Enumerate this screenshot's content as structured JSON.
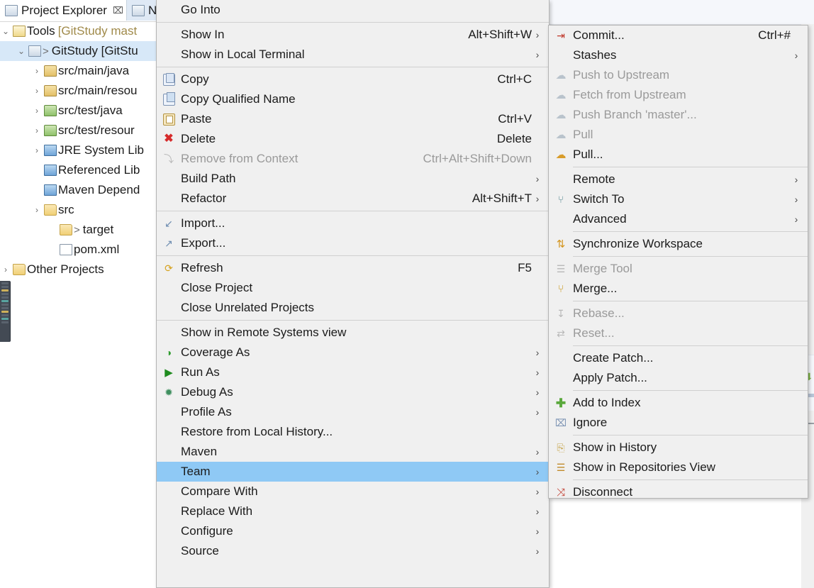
{
  "explorer": {
    "tabs": [
      {
        "label": "Project Explorer",
        "icon": "project-explorer-icon",
        "close": "⌧",
        "active": true
      },
      {
        "label": "Na",
        "icon": "navigator-icon",
        "active": false
      }
    ],
    "tree": [
      {
        "indent": 0,
        "twisty": "⌄",
        "icon": "working-set-icon",
        "label": "Tools",
        "suffix": "[GitStudy mast",
        "selected": false
      },
      {
        "indent": 1,
        "twisty": "⌄",
        "icon": "maven-project-icon",
        "prefix": ">",
        "label": "GitStudy [GitStu",
        "suffix": "",
        "selected": true
      },
      {
        "indent": 2,
        "twisty": "›",
        "icon": "source-package-icon",
        "label": "src/main/java",
        "selected": false
      },
      {
        "indent": 2,
        "twisty": "›",
        "icon": "source-package-icon",
        "label": "src/main/resou",
        "selected": false
      },
      {
        "indent": 2,
        "twisty": "›",
        "icon": "test-package-icon",
        "label": "src/test/java",
        "selected": false
      },
      {
        "indent": 2,
        "twisty": "›",
        "icon": "test-package-icon",
        "label": "src/test/resour",
        "selected": false
      },
      {
        "indent": 2,
        "twisty": "›",
        "icon": "library-icon",
        "label": "JRE System Lib",
        "selected": false
      },
      {
        "indent": 2,
        "twisty": "",
        "icon": "library-icon",
        "label": "Referenced Lib",
        "selected": false
      },
      {
        "indent": 2,
        "twisty": "",
        "icon": "library-icon",
        "label": "Maven Depend",
        "selected": false
      },
      {
        "indent": 2,
        "twisty": "›",
        "icon": "folder-icon",
        "label": "src",
        "selected": false
      },
      {
        "indent": 3,
        "twisty": "",
        "icon": "folder-question-icon",
        "prefix": ">",
        "label": "target",
        "selected": false
      },
      {
        "indent": 3,
        "twisty": "",
        "icon": "xml-file-icon",
        "label": "pom.xml",
        "selected": false
      },
      {
        "indent": 0,
        "twisty": "›",
        "icon": "other-projects-icon",
        "label": "Other Projects",
        "selected": false
      }
    ]
  },
  "context_menu": {
    "name": "project-context-menu",
    "items": [
      {
        "label": "Go Into",
        "icon": "",
        "accel": "",
        "arrow": false,
        "disabled": false
      },
      {
        "sep": true
      },
      {
        "label": "Show In",
        "icon": "",
        "accel": "Alt+Shift+W",
        "arrow": true,
        "disabled": false
      },
      {
        "label": "Show in Local Terminal",
        "icon": "",
        "accel": "",
        "arrow": true,
        "disabled": false
      },
      {
        "sep": true
      },
      {
        "label": "Copy",
        "icon": "copy-icon",
        "accel": "Ctrl+C",
        "arrow": false,
        "disabled": false
      },
      {
        "label": "Copy Qualified Name",
        "icon": "copy-qualified-name-icon",
        "accel": "",
        "arrow": false,
        "disabled": false
      },
      {
        "label": "Paste",
        "icon": "paste-icon",
        "accel": "Ctrl+V",
        "arrow": false,
        "disabled": false
      },
      {
        "label": "Delete",
        "icon": "delete-icon",
        "accel": "Delete",
        "arrow": false,
        "disabled": false
      },
      {
        "label": "Remove from Context",
        "icon": "remove-from-context-icon",
        "accel": "Ctrl+Alt+Shift+Down",
        "arrow": false,
        "disabled": true
      },
      {
        "label": "Build Path",
        "icon": "",
        "accel": "",
        "arrow": true,
        "disabled": false
      },
      {
        "label": "Refactor",
        "icon": "",
        "accel": "Alt+Shift+T",
        "arrow": true,
        "disabled": false
      },
      {
        "sep": true
      },
      {
        "label": "Import...",
        "icon": "import-icon",
        "accel": "",
        "arrow": false,
        "disabled": false
      },
      {
        "label": "Export...",
        "icon": "export-icon",
        "accel": "",
        "arrow": false,
        "disabled": false
      },
      {
        "sep": true
      },
      {
        "label": "Refresh",
        "icon": "refresh-icon",
        "accel": "F5",
        "arrow": false,
        "disabled": false
      },
      {
        "label": "Close Project",
        "icon": "",
        "accel": "",
        "arrow": false,
        "disabled": false
      },
      {
        "label": "Close Unrelated Projects",
        "icon": "",
        "accel": "",
        "arrow": false,
        "disabled": false
      },
      {
        "sep": true
      },
      {
        "label": "Show in Remote Systems view",
        "icon": "",
        "accel": "",
        "arrow": false,
        "disabled": false
      },
      {
        "label": "Coverage As",
        "icon": "coverage-icon",
        "accel": "",
        "arrow": true,
        "disabled": false
      },
      {
        "label": "Run As",
        "icon": "run-icon",
        "accel": "",
        "arrow": true,
        "disabled": false
      },
      {
        "label": "Debug As",
        "icon": "debug-icon",
        "accel": "",
        "arrow": true,
        "disabled": false
      },
      {
        "label": "Profile As",
        "icon": "",
        "accel": "",
        "arrow": true,
        "disabled": false
      },
      {
        "label": "Restore from Local History...",
        "icon": "",
        "accel": "",
        "arrow": false,
        "disabled": false
      },
      {
        "label": "Maven",
        "icon": "",
        "accel": "",
        "arrow": true,
        "disabled": false
      },
      {
        "label": "Team",
        "icon": "",
        "accel": "",
        "arrow": true,
        "disabled": false,
        "highlighted": true
      },
      {
        "label": "Compare With",
        "icon": "",
        "accel": "",
        "arrow": true,
        "disabled": false
      },
      {
        "label": "Replace With",
        "icon": "",
        "accel": "",
        "arrow": true,
        "disabled": false
      },
      {
        "label": "Configure",
        "icon": "",
        "accel": "",
        "arrow": true,
        "disabled": false
      },
      {
        "label": "Source",
        "icon": "",
        "accel": "",
        "arrow": true,
        "disabled": false
      }
    ]
  },
  "team_submenu": {
    "name": "team-submenu",
    "items": [
      {
        "label": "Commit...",
        "icon": "commit-icon",
        "accel": "Ctrl+#",
        "arrow": false,
        "disabled": false
      },
      {
        "label": "Stashes",
        "icon": "",
        "accel": "",
        "arrow": true,
        "disabled": false
      },
      {
        "label": "Push to Upstream",
        "icon": "push-icon",
        "accel": "",
        "arrow": false,
        "disabled": true
      },
      {
        "label": "Fetch from Upstream",
        "icon": "fetch-icon",
        "accel": "",
        "arrow": false,
        "disabled": true
      },
      {
        "label": "Push Branch 'master'...",
        "icon": "push-branch-icon",
        "accel": "",
        "arrow": false,
        "disabled": true
      },
      {
        "label": "Pull",
        "icon": "pull-icon",
        "accel": "",
        "arrow": false,
        "disabled": true
      },
      {
        "label": "Pull...",
        "icon": "pull-config-icon",
        "accel": "",
        "arrow": false,
        "disabled": false
      },
      {
        "sep": true
      },
      {
        "label": "Remote",
        "icon": "",
        "accel": "",
        "arrow": true,
        "disabled": false
      },
      {
        "label": "Switch To",
        "icon": "switch-to-icon",
        "accel": "",
        "arrow": true,
        "disabled": false
      },
      {
        "label": "Advanced",
        "icon": "",
        "accel": "",
        "arrow": true,
        "disabled": false
      },
      {
        "sep": true
      },
      {
        "label": "Synchronize Workspace",
        "icon": "synchronize-icon",
        "accel": "",
        "arrow": false,
        "disabled": false
      },
      {
        "sep": true
      },
      {
        "label": "Merge Tool",
        "icon": "merge-tool-icon",
        "accel": "",
        "arrow": false,
        "disabled": true
      },
      {
        "label": "Merge...",
        "icon": "merge-icon",
        "accel": "",
        "arrow": false,
        "disabled": false
      },
      {
        "sep": true
      },
      {
        "label": "Rebase...",
        "icon": "rebase-icon",
        "accel": "",
        "arrow": false,
        "disabled": true
      },
      {
        "label": "Reset...",
        "icon": "reset-icon",
        "accel": "",
        "arrow": false,
        "disabled": true
      },
      {
        "sep": true
      },
      {
        "label": "Create Patch...",
        "icon": "",
        "accel": "",
        "arrow": false,
        "disabled": false
      },
      {
        "label": "Apply Patch...",
        "icon": "",
        "accel": "",
        "arrow": false,
        "disabled": false
      },
      {
        "sep": true
      },
      {
        "label": "Add to Index",
        "icon": "add-to-index-icon",
        "accel": "",
        "arrow": false,
        "disabled": false
      },
      {
        "label": "Ignore",
        "icon": "ignore-icon",
        "accel": "",
        "arrow": false,
        "disabled": false
      },
      {
        "sep": true
      },
      {
        "label": "Show in History",
        "icon": "history-icon",
        "accel": "",
        "arrow": false,
        "disabled": false
      },
      {
        "label": "Show in Repositories View",
        "icon": "repositories-view-icon",
        "accel": "",
        "arrow": false,
        "disabled": false
      },
      {
        "sep": true
      },
      {
        "label": "Disconnect",
        "icon": "disconnect-icon",
        "accel": "",
        "arrow": false,
        "disabled": false
      }
    ]
  },
  "colors": {
    "menu_background": "#f0f0f0",
    "menu_border": "#b5b5b5",
    "highlight": "#8fc9f5",
    "tree_selection": "#d7e8f8",
    "text": "#1b1b1b",
    "disabled_text": "#9a9a9a",
    "separator": "#d0d0d0",
    "tab_inactive": "#dfe9f5"
  }
}
